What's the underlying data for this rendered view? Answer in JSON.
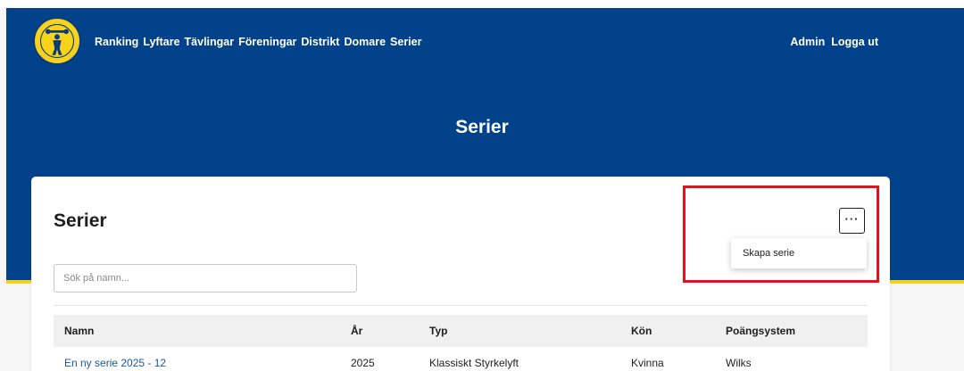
{
  "nav": {
    "items": [
      "Ranking",
      "Lyftare",
      "Tävlingar",
      "Föreningar",
      "Distrikt",
      "Domare",
      "Serier"
    ],
    "right": [
      "Admin",
      "Logga ut"
    ]
  },
  "hero": {
    "title": "Serier"
  },
  "card": {
    "title": "Serier",
    "search_placeholder": "Sök på namn...",
    "menu_button": "···",
    "dropdown_item": "Skapa serie"
  },
  "table": {
    "columns": [
      "Namn",
      "År",
      "Typ",
      "Kön",
      "Poängsystem"
    ],
    "rows": [
      [
        "En ny serie 2025 - 12",
        "2025",
        "Klassiskt Styrkelyft",
        "Kvinna",
        "Wilks"
      ]
    ]
  },
  "colors": {
    "header": "#02428a",
    "accent": "#f2d21b",
    "highlight": "#e2131b",
    "link": "#1a5aa6"
  }
}
